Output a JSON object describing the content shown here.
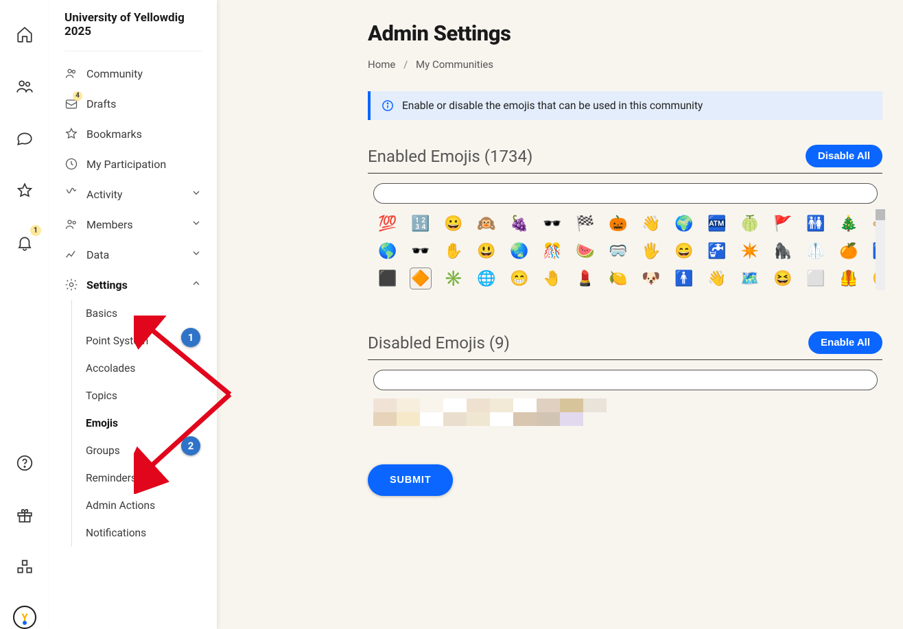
{
  "rail": {
    "notif_badge": "1"
  },
  "sidebar": {
    "community_title": "University of Yellowdig 2025",
    "items": [
      {
        "label": "Community"
      },
      {
        "label": "Drafts",
        "badge": "4"
      },
      {
        "label": "Bookmarks"
      },
      {
        "label": "My Participation"
      },
      {
        "label": "Activity"
      },
      {
        "label": "Members"
      },
      {
        "label": "Data"
      },
      {
        "label": "Settings"
      }
    ],
    "settings_sub": [
      "Basics",
      "Point System",
      "Accolades",
      "Topics",
      "Emojis",
      "Groups",
      "Reminders",
      "Admin Actions",
      "Notifications"
    ]
  },
  "page": {
    "title": "Admin Settings",
    "breadcrumb_home": "Home",
    "breadcrumb_current": "My Communities",
    "info_text": "Enable or disable the emojis that can be used in this community",
    "enabled_title": "Enabled Emojis (1734)",
    "disable_all": "Disable All",
    "disabled_title": "Disabled Emojis (9)",
    "enable_all": "Enable All",
    "submit": "SUBMIT"
  },
  "enabled_emojis": {
    "row1": [
      "💯",
      "🔢",
      "😀",
      "🙉",
      "🍇",
      "🕶️",
      "🏁",
      "🎃",
      "👋",
      "🌍",
      "🏧",
      "🍈",
      "🚩",
      "🚻",
      "🎄",
      "🐵"
    ],
    "row2": [
      "🌎",
      "🕶️",
      "✋",
      "😃",
      "🌏",
      "🎊",
      "🍉",
      "🥽",
      "🖐️",
      "😄",
      "🚰",
      "✴️",
      "🦍",
      "🥼",
      "🍊",
      "♿"
    ],
    "row3": [
      "⬛",
      "🔶",
      "✳️",
      "🌐",
      "😁",
      "🤚",
      "💄",
      "🍋",
      "🐶",
      "🚹",
      "👋",
      "🗺️",
      "😆",
      "⬜",
      "🦺",
      "😅"
    ]
  },
  "disabled_swatches": [
    "#f0e3d6",
    "#f7eedd",
    "#f9f4ec",
    "#fff",
    "#efe1cf",
    "#f2ead7",
    "#fff",
    "#e0d0c0",
    "#d8c49a",
    "#eae3da",
    "#e6d3b9",
    "#f5e9c9",
    "#fff",
    "#eadfce",
    "#f0e7d2",
    "#fff",
    "#d8c6b0",
    "#d2c4b3",
    "#e3d9ee"
  ],
  "annotations": {
    "marker1": "1",
    "marker2": "2"
  },
  "avatar_letter": "Y"
}
